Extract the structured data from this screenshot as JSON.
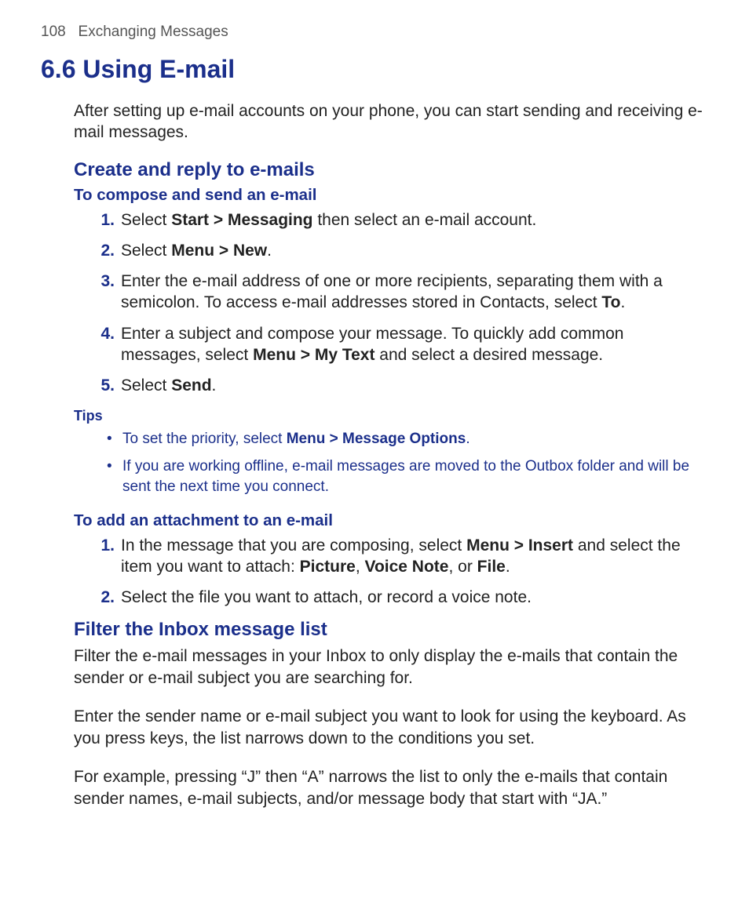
{
  "header": {
    "page_number": "108",
    "chapter": "Exchanging Messages"
  },
  "main": {
    "title": "6.6 Using E-mail",
    "intro": "After setting up e-mail accounts on your phone, you can start sending and receiving e-mail messages.",
    "section1": {
      "title": "Create and reply to e-mails",
      "subA": {
        "title": "To compose and send an e-mail",
        "steps": [
          {
            "num": "1.",
            "pre": "Select ",
            "bold1": "Start > Messaging",
            "post": " then select an e-mail account."
          },
          {
            "num": "2.",
            "pre": "Select ",
            "bold1": "Menu > New",
            "post": "."
          },
          {
            "num": "3.",
            "text": "Enter the e-mail address of one or more recipients, separating them with a semicolon. To access e-mail addresses stored in Contacts, select ",
            "bold1": "To",
            "post": "."
          },
          {
            "num": "4.",
            "text": "Enter a subject and compose your message. To quickly add common messages, select ",
            "bold1": "Menu > My Text",
            "post": " and select a desired message."
          },
          {
            "num": "5.",
            "pre": "Select ",
            "bold1": "Send",
            "post": "."
          }
        ]
      },
      "tips": {
        "label": "Tips",
        "items": [
          {
            "pre": "To set the priority, select ",
            "bold": "Menu > Message Options",
            "post": "."
          },
          {
            "text": "If you are working offline, e-mail messages are moved to the Outbox folder and will be sent the next time you connect."
          }
        ]
      },
      "subB": {
        "title": "To add an attachment to an e-mail",
        "steps": [
          {
            "num": "1.",
            "pre": "In the message that you are composing, select ",
            "bold1": "Menu > Insert",
            "mid": " and select the item you want to attach: ",
            "bold2": "Picture",
            "sep1": ", ",
            "bold3": "Voice Note",
            "sep2": ", or ",
            "bold4": "File",
            "post": "."
          },
          {
            "num": "2.",
            "text": "Select the file you want to attach, or record a voice note."
          }
        ]
      }
    },
    "section2": {
      "title": "Filter the Inbox message list",
      "paras": [
        "Filter the e-mail messages in your Inbox to only display the e-mails that contain the sender or e-mail subject you are searching for.",
        "Enter the sender name or e-mail subject you want to look for using the keyboard. As you press keys, the list narrows down to the conditions you set.",
        "For example, pressing “J” then “A” narrows the list to only the e-mails that contain sender names, e-mail subjects, and/or message body that start with “JA.”"
      ]
    }
  }
}
